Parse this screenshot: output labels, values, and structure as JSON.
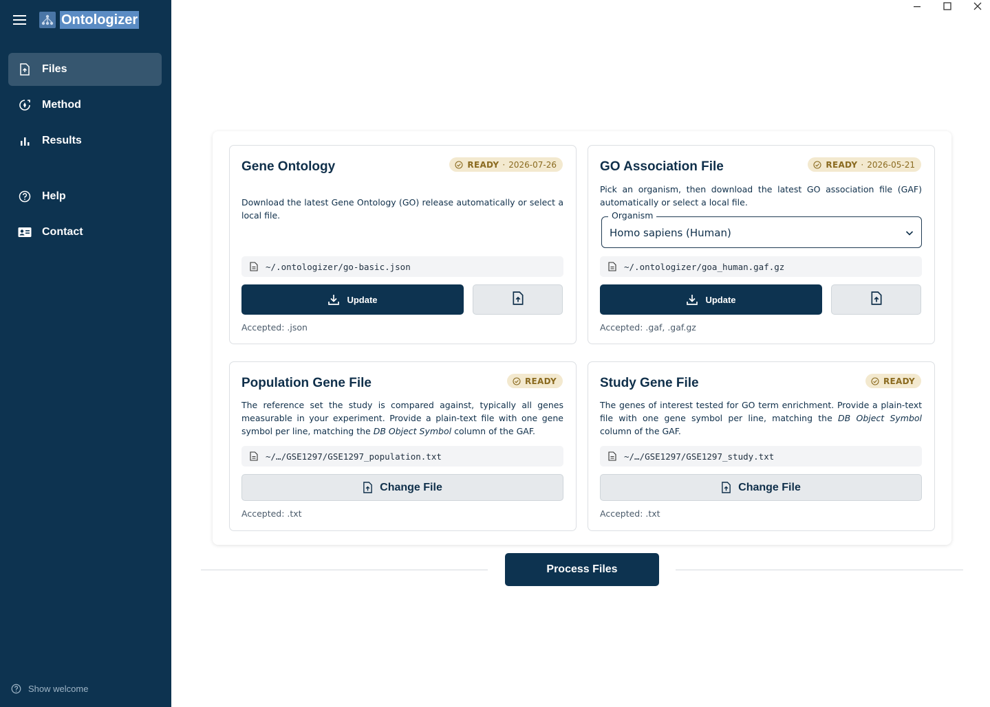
{
  "app": {
    "name": "Ontologizer"
  },
  "sidebar": {
    "items": [
      {
        "label": "Files",
        "icon": "file-upload-icon",
        "active": true
      },
      {
        "label": "Method",
        "icon": "method-icon",
        "active": false
      },
      {
        "label": "Results",
        "icon": "bar-chart-icon",
        "active": false
      },
      {
        "label": "Help",
        "icon": "help-circle-icon",
        "active": false
      },
      {
        "label": "Contact",
        "icon": "contact-card-icon",
        "active": false
      }
    ],
    "show_welcome": "Show welcome"
  },
  "cards": {
    "gene_ontology": {
      "title": "Gene Ontology",
      "status": "READY",
      "date": "2026-07-26",
      "description": "Download the latest Gene Ontology (GO) release automatically or select a local file.",
      "path": "~/.ontologizer/go-basic.json",
      "update_label": "Update",
      "accepted": "Accepted: .json"
    },
    "association": {
      "title": "GO Association File",
      "status": "READY",
      "date": "2026-05-21",
      "description": "Pick an organism, then download the latest GO association file (GAF) automatically or select a local file.",
      "organism_label": "Organism",
      "organism_value": "Homo sapiens (Human)",
      "path": "~/.ontologizer/goa_human.gaf.gz",
      "update_label": "Update",
      "accepted": "Accepted: .gaf, .gaf.gz"
    },
    "population": {
      "title": "Population Gene File",
      "status": "READY",
      "desc_pre": "The reference set the study is compared against, typically all genes measurable in your experiment. Provide a plain-text file with one gene symbol per line, matching the ",
      "desc_em": "DB Object Symbol",
      "desc_post": " column of the GAF.",
      "path": "~/…/GSE1297/GSE1297_population.txt",
      "change_label": "Change File",
      "accepted": "Accepted: .txt"
    },
    "study": {
      "title": "Study Gene File",
      "status": "READY",
      "desc_pre": "The genes of interest tested for GO term enrichment. Provide a plain-text file with one gene symbol per line, matching the ",
      "desc_em": "DB Object Symbol",
      "desc_post": " column of the GAF.",
      "path": "~/…/GSE1297/GSE1297_study.txt",
      "change_label": "Change File",
      "accepted": "Accepted: .txt"
    }
  },
  "process_label": "Process Files",
  "colors": {
    "sidebar_bg": "#0d3350",
    "accent": "#0d3350",
    "badge_bg": "#f3e9cf",
    "badge_text": "#8a6a1f"
  }
}
